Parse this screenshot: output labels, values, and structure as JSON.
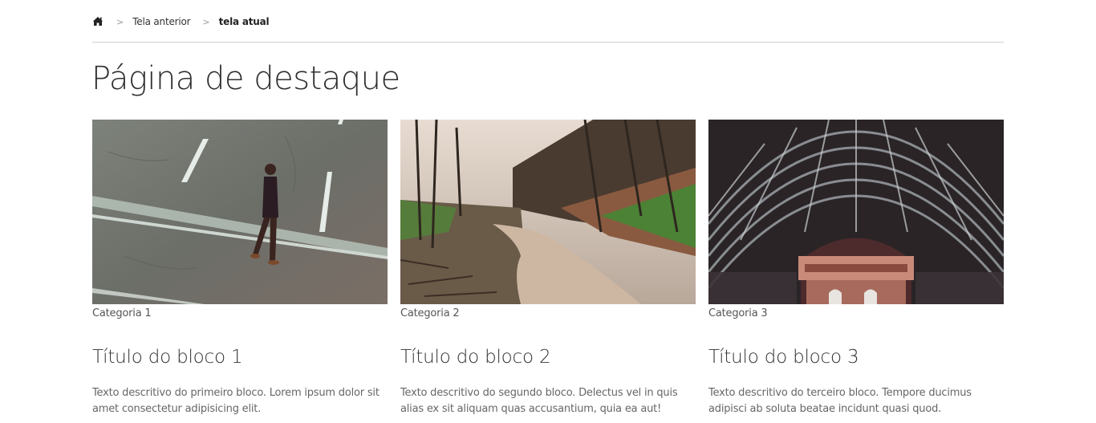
{
  "breadcrumb": {
    "home_icon": "home-icon",
    "separator": ">",
    "previous": "Tela anterior",
    "current": "tela atual"
  },
  "page": {
    "title": "Página de destaque"
  },
  "cards": [
    {
      "image": "street-person-walking-photo",
      "category": "Categoria 1",
      "title": "Título do bloco 1",
      "description": "Texto descritivo do primeiro bloco. Lorem ipsum dolor sit amet consectetur adipisicing elit."
    },
    {
      "image": "forest-dirt-road-photo",
      "category": "Categoria 2",
      "title": "Título do bloco 2",
      "description": "Texto descritivo do segundo bloco. Delectus vel in quis alias ex sit aliquam quas accusantium, quia ea aut!"
    },
    {
      "image": "arched-station-roof-photo",
      "category": "Categoria 3",
      "title": "Título do bloco 3",
      "description": "Texto descritivo do terceiro bloco. Tempore ducimus adipisci ab soluta beatae incidunt quasi quod."
    }
  ]
}
